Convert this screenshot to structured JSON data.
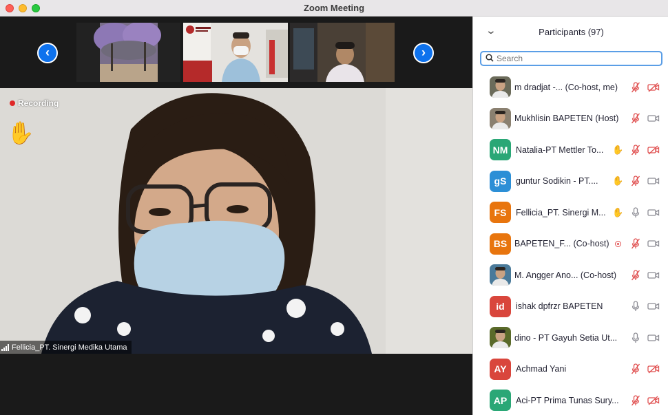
{
  "window": {
    "title": "Zoom Meeting"
  },
  "gallery": {
    "prev_icon": "chevron-left-icon",
    "next_icon": "chevron-right-icon"
  },
  "main_video": {
    "recording_label": "Recording",
    "speaker_name": "Fellicia_PT. Sinergi Medika Utama"
  },
  "participants_panel": {
    "title": "Participants (97)",
    "search_placeholder": "Search",
    "participants": [
      {
        "name": "m dradjat -...  (Co-host, me)",
        "avatar_text": "",
        "avatar_color": "#6b6b5a",
        "hand": false,
        "mic": "muted",
        "cam": "off"
      },
      {
        "name": "Mukhlisin BAPETEN (Host)",
        "avatar_text": "",
        "avatar_color": "#8a8070",
        "hand": false,
        "mic": "muted",
        "cam": "on"
      },
      {
        "name": "Natalia-PT Mettler To...",
        "avatar_text": "NM",
        "avatar_color": "#2aa776",
        "hand": true,
        "mic": "muted",
        "cam": "off"
      },
      {
        "name": "guntur Sodikin - PT....",
        "avatar_text": "gS",
        "avatar_color": "#2c8fd6",
        "hand": true,
        "mic": "muted",
        "cam": "on"
      },
      {
        "name": "Fellicia_PT. Sinergi M...",
        "avatar_text": "FS",
        "avatar_color": "#e8750e",
        "hand": true,
        "mic": "on",
        "cam": "on"
      },
      {
        "name": "BAPETEN_F...  (Co-host)",
        "avatar_text": "BS",
        "avatar_color": "#e8750e",
        "hand": false,
        "mic": "muted",
        "cam": "on"
      },
      {
        "name": "M. Angger Ano...  (Co-host)",
        "avatar_text": "",
        "avatar_color": "#4a7a9a",
        "hand": false,
        "mic": "muted",
        "cam": "on"
      },
      {
        "name": "ishak dpfrzr BAPETEN",
        "avatar_text": "id",
        "avatar_color": "#d9463c",
        "hand": false,
        "mic": "on",
        "cam": "on"
      },
      {
        "name": "dino - PT Gayuh Setia Ut...",
        "avatar_text": "",
        "avatar_color": "#5a6a2a",
        "hand": false,
        "mic": "on",
        "cam": "on"
      },
      {
        "name": "Achmad Yani",
        "avatar_text": "AY",
        "avatar_color": "#d9463c",
        "hand": false,
        "mic": "muted",
        "cam": "off"
      },
      {
        "name": "Aci-PT Prima Tunas Sury...",
        "avatar_text": "AP",
        "avatar_color": "#2aa776",
        "hand": false,
        "mic": "muted",
        "cam": "off"
      }
    ]
  },
  "colors": {
    "accent": "#0e72ed",
    "muted_red": "#e05050",
    "icon_gray": "#8c8c94"
  }
}
